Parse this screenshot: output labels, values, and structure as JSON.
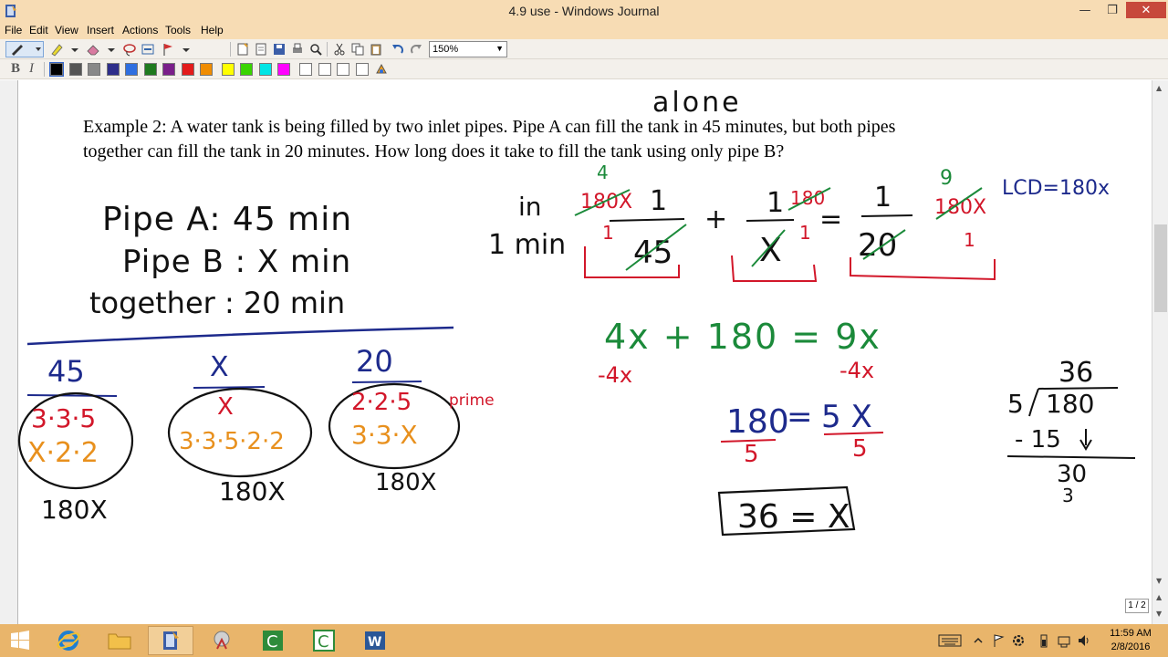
{
  "window": {
    "title": "4.9 use - Windows Journal",
    "minimize": "—",
    "restore": "❐",
    "close": "✕"
  },
  "menu": [
    "File",
    "Edit",
    "View",
    "Insert",
    "Actions",
    "Tools",
    "Help"
  ],
  "toolbar": {
    "zoom": "150%",
    "bold": "B",
    "italic": "I"
  },
  "colors": {
    "titlebar": "#f7dcb4",
    "taskbar": "#e9b56b",
    "ink_black": "#111111",
    "ink_blue": "#1d2a8c",
    "ink_red": "#d2172a",
    "ink_green": "#1b8a3a",
    "ink_orange": "#e8901d"
  },
  "palette": [
    "#000000",
    "#555555",
    "#888888",
    "#2e2e8a",
    "#2f6fe0",
    "#1f7a1f",
    "#7a1f8a",
    "#e31b1b",
    "#f08c00",
    "#ffff00",
    "#39d400",
    "#00e5e5",
    "#ff00ff",
    "#ffffff",
    "#ffffff",
    "#ffffff",
    "#ffffff"
  ],
  "note": {
    "problem_line1": "Example 2: A water tank is being filled by two inlet pipes. Pipe A can fill the tank in 45 minutes, but both pipes",
    "problem_line2": "together can fill the tank in 20 minutes. How long does it take to fill the tank using only pipe B?",
    "ink": {
      "alone": "alone",
      "pipe_a": "Pipe A: 45 min",
      "pipe_b": "Pipe B : X min",
      "together": "together : 20 min",
      "in_label": "in",
      "one_min": "1 min",
      "lcd": "LCD=180x",
      "head_45": "45",
      "head_x": "X",
      "head_20": "20",
      "fact_45_red": "3·3·5",
      "fact_45_orange": "X·2·2",
      "fact_x_red": "X",
      "fact_x_orange": "3·3·5·2·2",
      "fact_20_red": "2·2·5",
      "fact_20_orange": "3·3·X",
      "prime": "prime",
      "lcd_45": "180X",
      "lcd_x": "180X",
      "lcd_20": "180X",
      "eq1_num": "1",
      "eq1_den": "45",
      "eq1_mult": "180X",
      "eq1_reduced": "4",
      "plus": "+",
      "eq2_num": "1",
      "eq2_den": "X",
      "eq2_mult": "180",
      "eq_sign": "=",
      "eq3_num": "1",
      "eq3_den": "20",
      "eq3_mult": "180X",
      "eq3_reduced": "9",
      "one_a": "1",
      "one_b": "1",
      "one_c": "1",
      "linear": "4x + 180 = 9x",
      "minus_left": "-4x",
      "minus_right": "-4x",
      "step_num_left": "180",
      "step_den_left": "5",
      "step_eq": "=",
      "step_num_right": "5 X",
      "step_den_right": "5",
      "answer": "36 = X",
      "div_quot": "36",
      "div_divisor": "5",
      "div_dividend": "180",
      "div_sub": "- 15",
      "div_rem": "30",
      "div_rem2": "3"
    }
  },
  "page_indicator": "1 / 2",
  "clock": {
    "time": "11:59 AM",
    "date": "2/8/2016"
  },
  "taskbar_apps": [
    "windows-start",
    "internet-explorer",
    "file-explorer",
    "windows-journal",
    "snipping-tool",
    "camtasia-recorder",
    "camtasia-studio",
    "word"
  ]
}
